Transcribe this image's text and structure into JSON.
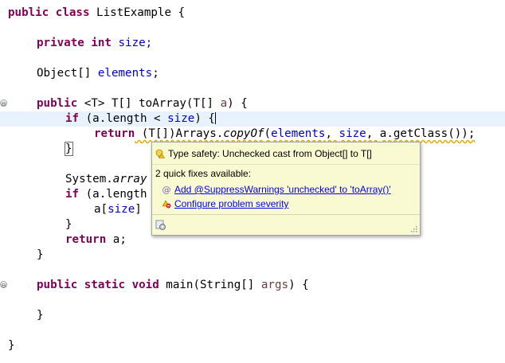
{
  "editor": {
    "lines": {
      "l1": {
        "kw1": "public",
        "kw2": "class",
        "rest": " ListExample {"
      },
      "l2": {
        "kw1": "private",
        "kw2": "int",
        "rest": " size;"
      },
      "l3": {
        "type": "Object[]",
        "field": "elements",
        "rest": ";"
      },
      "l4": {
        "kw1": "public",
        "rest": " <T> T[] toArray(T[] ",
        "param": "a",
        "tail": ") {"
      },
      "l5": {
        "kw": "if",
        "a": " (a.length < ",
        "field": "size",
        "tail": ") {"
      },
      "l6": {
        "kw": "return",
        "pre": " (T[])Arrays.",
        "method": "copyOf",
        "open": "(",
        "field1": "elements",
        "comma1": ", ",
        "field2": "size",
        "comma2": ", ",
        "rest": "a.getClass());"
      },
      "l7": {
        "brace": "}"
      },
      "l8": {
        "pre": "System.",
        "method": "array"
      },
      "l9": {
        "kw": "if",
        "rest": " (a.length"
      },
      "l10": {
        "pre": "a[",
        "field": "size",
        "rest": "]"
      },
      "l11": {
        "brace": "}"
      },
      "l12": {
        "kw": "return",
        "rest": " a;"
      },
      "l13": {
        "brace": "}"
      },
      "l14": {
        "kw1": "public",
        "kw2": "static",
        "kw3": "void",
        "rest": " main(String[] ",
        "param": "args",
        "tail": ") {"
      },
      "l15": {
        "brace": "}"
      },
      "l16": {
        "brace": "}"
      }
    },
    "fold_symbol": "⊖"
  },
  "quickfix": {
    "title": "Type safety: Unchecked cast from Object[] to T[]",
    "count_text": "2 quick fixes available:",
    "fixes": [
      {
        "label": "Add @SuppressWarnings 'unchecked' to 'toArray()'",
        "icon": "at-annotation-icon"
      },
      {
        "label": "Configure problem severity",
        "icon": "configure-severity-icon"
      }
    ],
    "colors": {
      "background": "#fafad2",
      "link": "#0000ee",
      "keyword": "#7f0055",
      "field": "#0000c0"
    }
  }
}
